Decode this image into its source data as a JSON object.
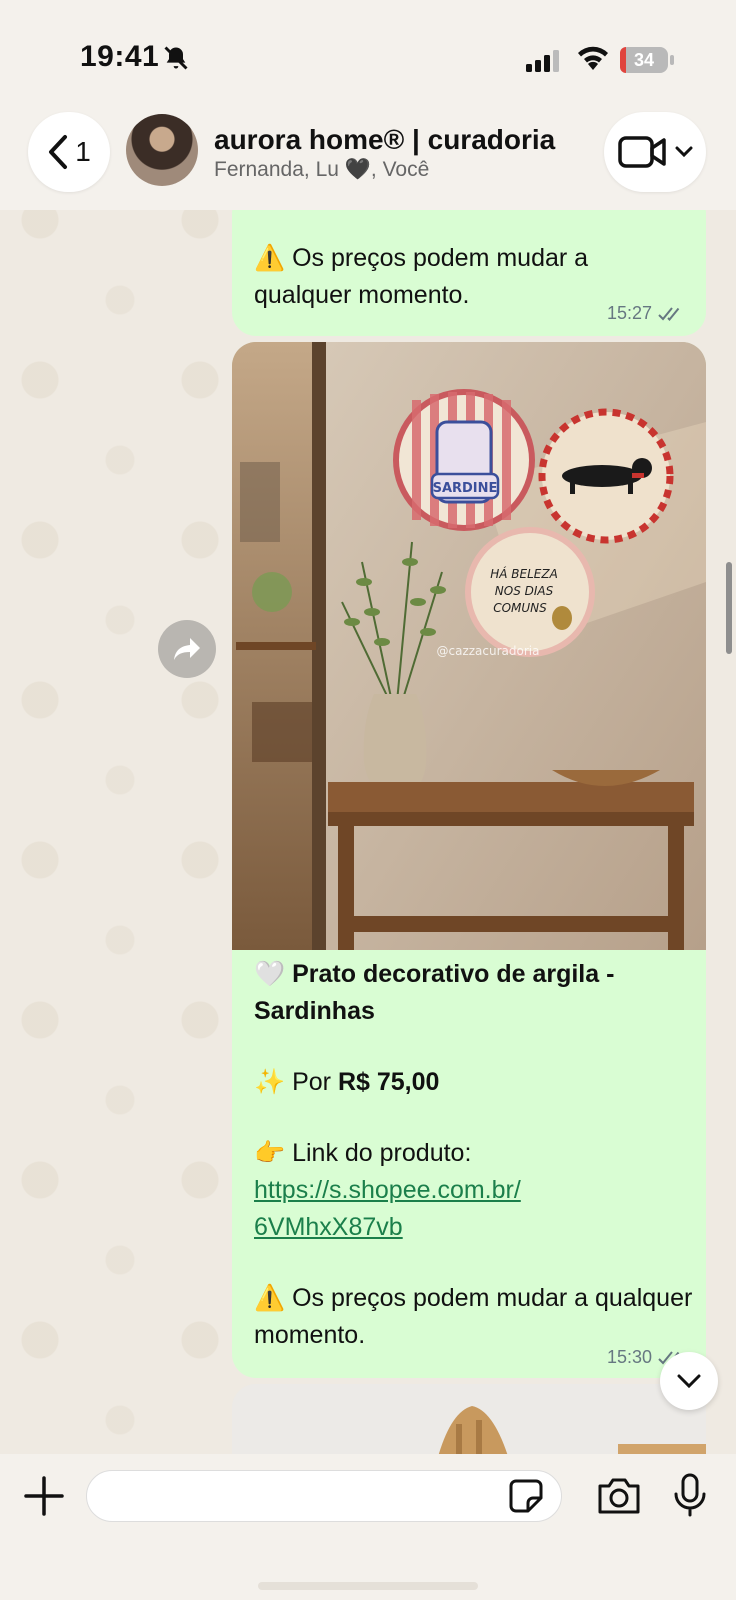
{
  "status_bar": {
    "time": "19:41",
    "battery": "34"
  },
  "header": {
    "back_count": "1",
    "title": "aurora home® | curadoria",
    "subtitle": "Fernanda, Lu 🖤, Você"
  },
  "messages": [
    {
      "text": "⚠️ Os preços podem mudar a qualquer momento.",
      "time": "15:27"
    },
    {
      "image_alt": "Prato decorativo de argila - Sardinhas",
      "image_watermark": "@cazzacuradoria",
      "plates": {
        "sardine": "SARDINE",
        "phrase_1": "HÁ BELEZA",
        "phrase_2": "NOS DIAS",
        "phrase_3": "COMUNS"
      },
      "title_emoji": "🤍",
      "title": "Prato decorativo de argila - Sardinhas",
      "price_emoji": "✨",
      "price_prefix": "Por",
      "price": "R$ 75,00",
      "link_emoji": "👉",
      "link_label": "Link do produto:",
      "link_line1": "https://s.shopee.com.br/",
      "link_line2": "6VMhxX87vb",
      "warning": "⚠️ Os preços podem mudar a qualquer momento.",
      "time": "15:30"
    }
  ],
  "composer": {
    "placeholder": ""
  },
  "colors": {
    "bubble_out": "#d9fdd3",
    "chat_bg": "#efeae2",
    "link": "#1b7f4b"
  }
}
